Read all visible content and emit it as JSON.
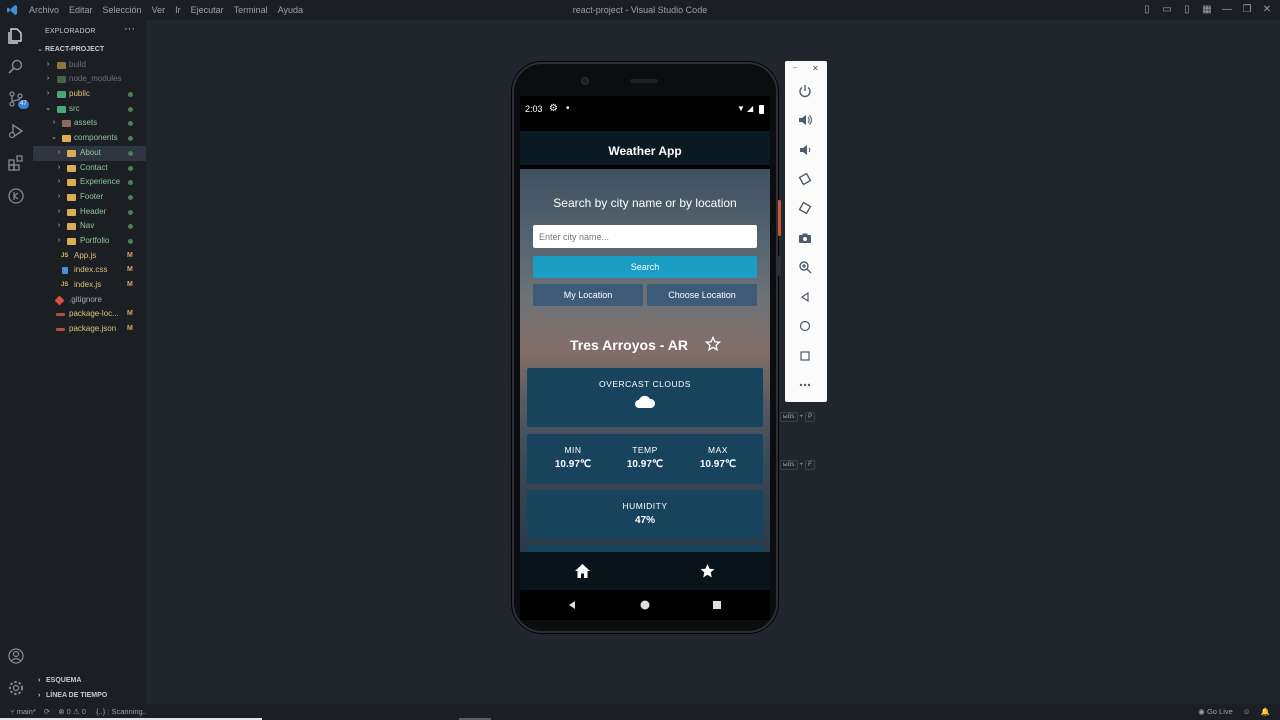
{
  "window": {
    "title": "react-project - Visual Studio Code",
    "menu": [
      "Archivo",
      "Editar",
      "Selección",
      "Ver",
      "Ir",
      "Ejecutar",
      "Terminal",
      "Ayuda"
    ]
  },
  "activity": {
    "scm_badge": "47"
  },
  "explorer": {
    "header": "EXPLORADOR",
    "more": "···",
    "project": "REACT-PROJECT",
    "items": [
      {
        "label": "build",
        "type": "folder"
      },
      {
        "label": "node_modules",
        "type": "folder"
      },
      {
        "label": "public",
        "type": "folder"
      },
      {
        "label": "src",
        "type": "folder"
      },
      {
        "label": "assets",
        "type": "folder"
      },
      {
        "label": "components",
        "type": "folder"
      },
      {
        "label": "About",
        "type": "folder"
      },
      {
        "label": "Contact",
        "type": "folder"
      },
      {
        "label": "Experience",
        "type": "folder"
      },
      {
        "label": "Footer",
        "type": "folder"
      },
      {
        "label": "Header",
        "type": "folder"
      },
      {
        "label": "Nav",
        "type": "folder"
      },
      {
        "label": "Portfolio",
        "type": "folder"
      },
      {
        "label": "App.js",
        "type": "file",
        "badge": "M",
        "icon": "JS"
      },
      {
        "label": "index.css",
        "type": "file",
        "badge": "M"
      },
      {
        "label": "index.js",
        "type": "file",
        "badge": "M",
        "icon": "JS"
      },
      {
        "label": ".gitignore",
        "type": "file"
      },
      {
        "label": "package-loc...",
        "type": "file",
        "badge": "M"
      },
      {
        "label": "package.json",
        "type": "file",
        "badge": "M"
      }
    ],
    "outline": "ESQUEMA",
    "timeline": "LÍNEA DE TIEMPO"
  },
  "statusbar": {
    "branch": "main*",
    "errors": "0",
    "warnings": "0",
    "scanning": "{..} : Scanning..",
    "golive": "Go Live"
  },
  "phone": {
    "time": "2:03",
    "app_title": "Weather App",
    "search_title": "Search by city name or by location",
    "city_placeholder": "Enter city name...",
    "search_button": "Search",
    "my_location_button": "My Location",
    "choose_location_button": "Choose Location",
    "city": "Tres Arroyos - AR",
    "condition": "OVERCAST CLOUDS",
    "min_label": "MIN",
    "min_value": "10.97℃",
    "temp_label": "TEMP",
    "temp_value": "10.97℃",
    "max_label": "MAX",
    "max_value": "10.97℃",
    "humidity_label": "HUMIDITY",
    "humidity_value": "47%"
  },
  "shortcuts": [
    {
      "mod": "ыűs",
      "key": "P"
    },
    {
      "mod": "ыűs",
      "key": "F"
    }
  ],
  "colors": {
    "accent": "#1a9ec4",
    "card": "#17435c",
    "button": "#3d5a78"
  }
}
